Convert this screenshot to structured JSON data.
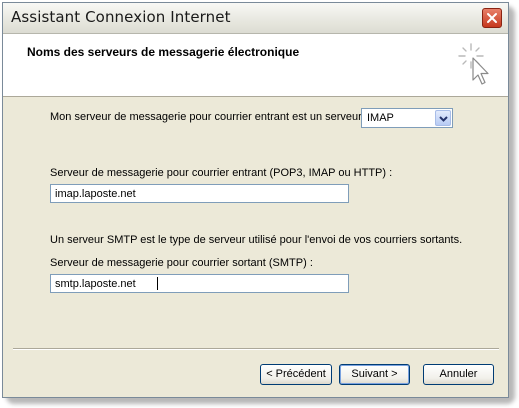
{
  "window": {
    "title": "Assistant Connexion Internet"
  },
  "header": {
    "title": "Noms des serveurs de messagerie électronique"
  },
  "incoming_type": {
    "label": "Mon serveur de messagerie pour courrier entrant est un serveur",
    "selected": "IMAP"
  },
  "incoming_server": {
    "label": "Serveur de messagerie pour courrier entrant (POP3, IMAP ou HTTP) :",
    "value": "imap.laposte.net"
  },
  "smtp_note": "Un serveur SMTP est le type de serveur utilisé pour l'envoi de vos courriers sortants.",
  "outgoing_server": {
    "label": "Serveur de messagerie pour courrier sortant (SMTP) :",
    "value": "smtp.laposte.net"
  },
  "buttons": {
    "back": "< Précédent",
    "next": "Suivant >",
    "cancel": "Annuler"
  },
  "icons": {
    "close": "close-icon",
    "wizard": "cursor-sparkle-icon",
    "dropdown": "chevron-down-icon"
  }
}
